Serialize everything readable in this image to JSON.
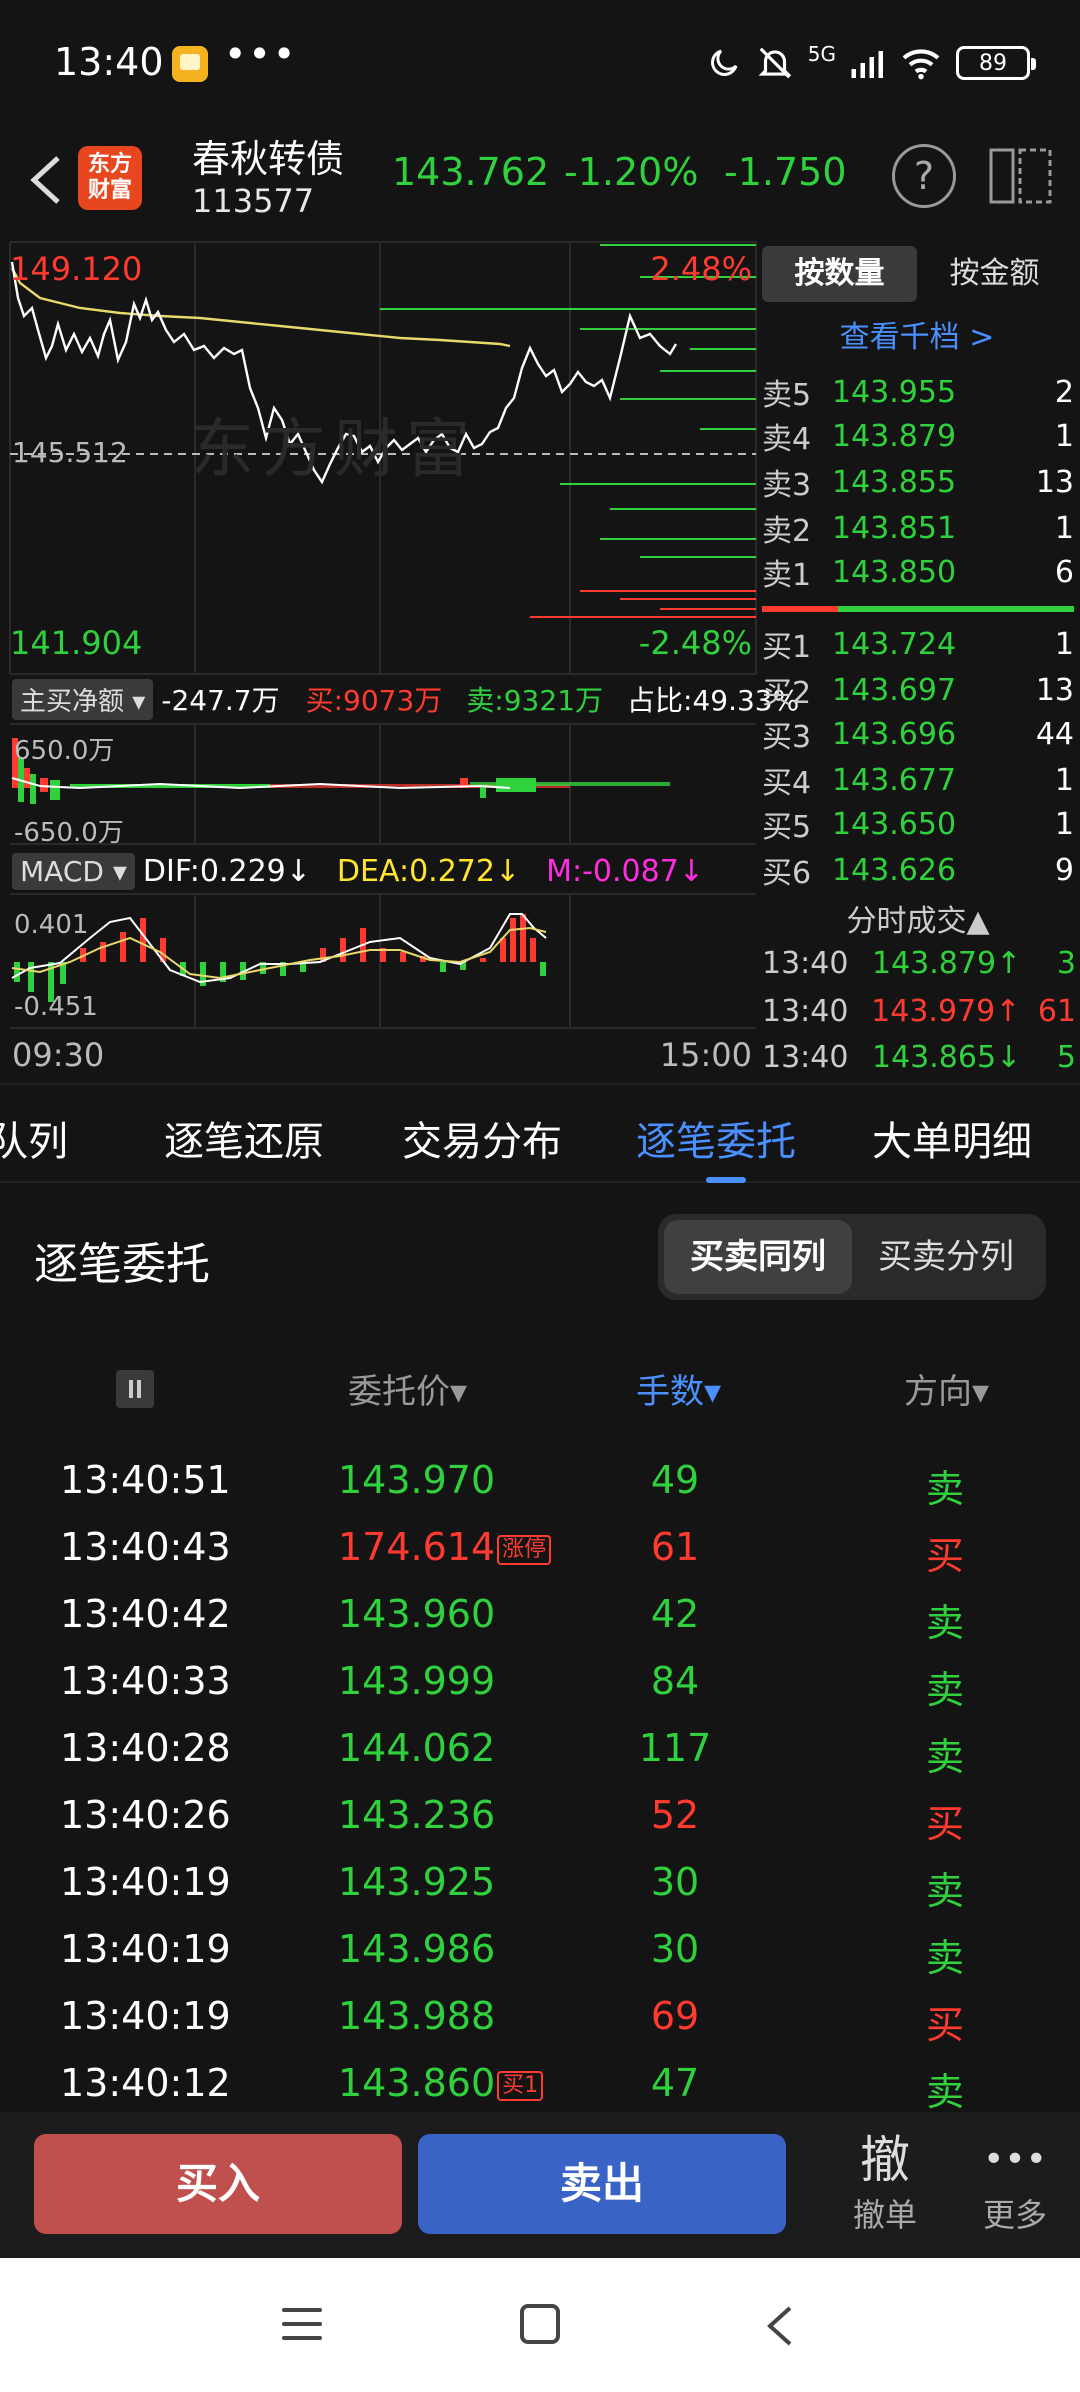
{
  "status": {
    "time": "13:40",
    "dots": "•••",
    "battery": "89",
    "network": "5G"
  },
  "header": {
    "logo": "东方\n财富",
    "name": "春秋转债",
    "code": "113577",
    "price": "143.762",
    "pct": "-1.20%",
    "change": "-1.750",
    "help": "?"
  },
  "chart": {
    "high_price": "149.120",
    "high_pct": "2.48%",
    "low_price": "141.904",
    "low_pct": "-2.48%",
    "ref_price": "145.512",
    "watermark": "东方财富",
    "net_label": "主买净额",
    "net_value": "-247.7万",
    "buy_amount": "买:9073万",
    "sell_amount": "卖:9321万",
    "ratio": "占比:49.33%",
    "vol_top": "650.0万",
    "vol_bottom": "-650.0万",
    "macd_label": "MACD",
    "dif": "DIF:0.229↓",
    "dea": "DEA:0.272↓",
    "m": "M:-0.087↓",
    "macd_top": "0.401",
    "macd_bottom": "-0.451",
    "time_start": "09:30",
    "time_end": "15:00"
  },
  "side": {
    "seg_on": "按数量",
    "seg_off": "按金额",
    "depth_link": "查看千档 >",
    "asks": [
      {
        "label": "卖5",
        "price": "143.955",
        "vol": "2"
      },
      {
        "label": "卖4",
        "price": "143.879",
        "vol": "1"
      },
      {
        "label": "卖3",
        "price": "143.855",
        "vol": "13"
      },
      {
        "label": "卖2",
        "price": "143.851",
        "vol": "1"
      },
      {
        "label": "卖1",
        "price": "143.850",
        "vol": "6"
      }
    ],
    "bids": [
      {
        "label": "买1",
        "price": "143.724",
        "vol": "1"
      },
      {
        "label": "买2",
        "price": "143.697",
        "vol": "13"
      },
      {
        "label": "买3",
        "price": "143.696",
        "vol": "44"
      },
      {
        "label": "买4",
        "price": "143.677",
        "vol": "1"
      },
      {
        "label": "买5",
        "price": "143.650",
        "vol": "1"
      },
      {
        "label": "买6",
        "price": "143.626",
        "vol": "9"
      }
    ],
    "trades_title": "分时成交▲",
    "trades": [
      {
        "time": "13:40",
        "price": "143.879↑",
        "vol": "3",
        "color": "#2fd13d"
      },
      {
        "time": "13:40",
        "price": "143.979↑",
        "vol": "61",
        "color": "#ff3b30"
      },
      {
        "time": "13:40",
        "price": "143.865↓",
        "vol": "5",
        "color": "#2fd13d"
      }
    ]
  },
  "tabs": [
    "队列",
    "逐笔还原",
    "交易分布",
    "逐笔委托",
    "大单明细"
  ],
  "orders": {
    "title": "逐笔委托",
    "toggle_on": "买卖同列",
    "toggle_off": "买卖分列",
    "col_price": "委托价▾",
    "col_qty": "手数▾",
    "col_dir": "方向▾",
    "rows": [
      {
        "time": "13:40:51",
        "price": "143.970",
        "tag": "",
        "qty": "49",
        "dir": "卖",
        "pcolor": "#2fd13d",
        "qcolor": "#2fd13d",
        "dcolor": "#2fd13d"
      },
      {
        "time": "13:40:43",
        "price": "174.614",
        "tag": "涨停",
        "qty": "61",
        "dir": "买",
        "pcolor": "#ff3b30",
        "qcolor": "#ff3b30",
        "dcolor": "#ff3b30"
      },
      {
        "time": "13:40:42",
        "price": "143.960",
        "tag": "",
        "qty": "42",
        "dir": "卖",
        "pcolor": "#2fd13d",
        "qcolor": "#2fd13d",
        "dcolor": "#2fd13d"
      },
      {
        "time": "13:40:33",
        "price": "143.999",
        "tag": "",
        "qty": "84",
        "dir": "卖",
        "pcolor": "#2fd13d",
        "qcolor": "#2fd13d",
        "dcolor": "#2fd13d"
      },
      {
        "time": "13:40:28",
        "price": "144.062",
        "tag": "",
        "qty": "117",
        "dir": "卖",
        "pcolor": "#2fd13d",
        "qcolor": "#2fd13d",
        "dcolor": "#2fd13d"
      },
      {
        "time": "13:40:26",
        "price": "143.236",
        "tag": "",
        "qty": "52",
        "dir": "买",
        "pcolor": "#2fd13d",
        "qcolor": "#ff3b30",
        "dcolor": "#ff3b30"
      },
      {
        "time": "13:40:19",
        "price": "143.925",
        "tag": "",
        "qty": "30",
        "dir": "卖",
        "pcolor": "#2fd13d",
        "qcolor": "#2fd13d",
        "dcolor": "#2fd13d"
      },
      {
        "time": "13:40:19",
        "price": "143.986",
        "tag": "",
        "qty": "30",
        "dir": "卖",
        "pcolor": "#2fd13d",
        "qcolor": "#2fd13d",
        "dcolor": "#2fd13d"
      },
      {
        "time": "13:40:19",
        "price": "143.988",
        "tag": "",
        "qty": "69",
        "dir": "买",
        "pcolor": "#2fd13d",
        "qcolor": "#ff3b30",
        "dcolor": "#ff3b30"
      },
      {
        "time": "13:40:12",
        "price": "143.860",
        "tag": "买1",
        "qty": "47",
        "dir": "卖",
        "pcolor": "#2fd13d",
        "qcolor": "#2fd13d",
        "dcolor": "#2fd13d"
      }
    ]
  },
  "actions": {
    "buy": "买入",
    "sell": "卖出",
    "cancel_icon": "撤",
    "cancel": "撤单",
    "more_icon": "•••",
    "more": "更多"
  },
  "colors": {
    "up": "#ff3b30",
    "down": "#2fd13d",
    "accent": "#4a90ff"
  }
}
